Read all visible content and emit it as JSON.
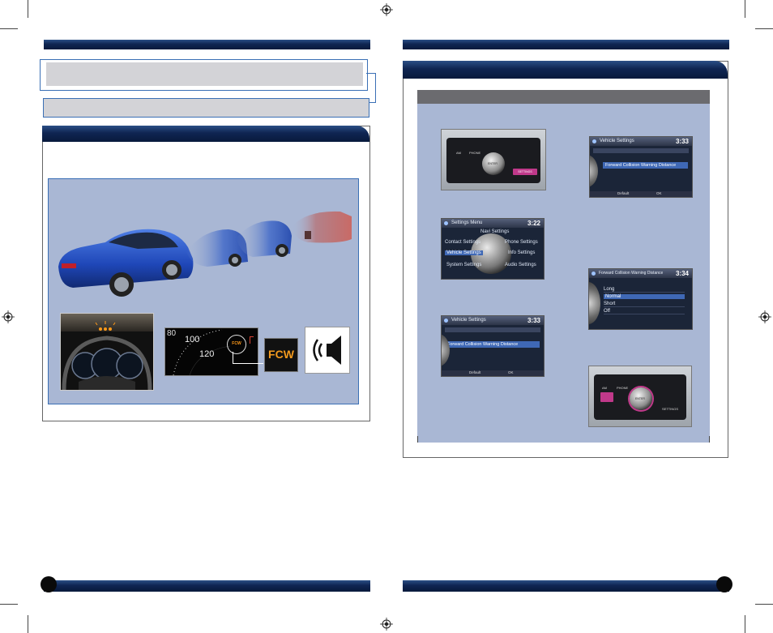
{
  "left_page": {
    "header_bar": "",
    "title_box_text": "",
    "subtitle_box_text": "",
    "feature_section": {
      "heading": "",
      "description": "",
      "illustration": {
        "cluster_image": "instrument-cluster-warning",
        "gauge_image": "speedometer-fcw-indicator",
        "gauge_numbers": [
          "80",
          "100",
          "120"
        ],
        "gauge_indicator_label": "FCW",
        "fcw_badge": "FCW",
        "fcw_badge_color": "#f39a1e",
        "sound_icon": "speaker-sound-icon"
      }
    },
    "footer_page_number": ""
  },
  "right_page": {
    "header_bar": "",
    "section_heading": "",
    "steps_header": "",
    "step_captions": {
      "step1": "",
      "step2": "",
      "step3": "",
      "step4": "",
      "step5": "",
      "step6": ""
    },
    "screens": {
      "settings_menu": {
        "title": "Settings Menu",
        "time": "3:22",
        "items": [
          "Navi Settings",
          "Contact Settings",
          "Phone Settings",
          "Vehicle Settings",
          "Info Settings",
          "System Settings",
          "Audio Settings"
        ]
      },
      "vehicle_settings_1": {
        "title": "Vehicle Settings",
        "time": "3:33",
        "selected_item": "Forward Collision Warning Distance",
        "footer_left": "Default",
        "footer_right": "OK"
      },
      "vehicle_settings_2": {
        "title": "Vehicle Settings",
        "time": "3:33",
        "selected_item": "Forward Collision Warning Distance",
        "footer_left": "Default",
        "footer_right": "OK"
      },
      "fcw_distance": {
        "title": "Forward Collision Warning Distance",
        "time": "3:34",
        "options": [
          "Long",
          "Normal",
          "Short",
          "Off"
        ],
        "selected": "Normal"
      }
    },
    "console_labels": {
      "left_top": "AM",
      "mid_top": "PHONE",
      "right_button": "SETTINGS",
      "knob_label": "ENTER"
    },
    "footer_page_number": ""
  },
  "colors": {
    "nav_blue": "#0f2552",
    "panel_blue": "#a9b7d4",
    "box_gray": "#d3d3d7",
    "steps_header_gray": "#6b6b6f"
  }
}
